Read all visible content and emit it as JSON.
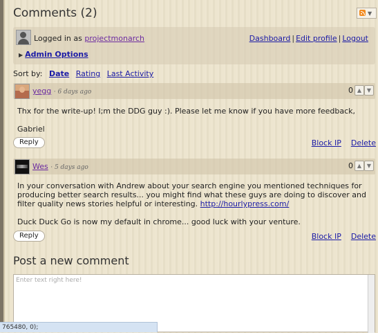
{
  "header": {
    "title": "Comments (2)",
    "rss_icon": "rss-feed-icon"
  },
  "user_box": {
    "logged_in_label": "Logged in as",
    "username": "projectmonarch",
    "links": {
      "dashboard": "Dashboard",
      "edit_profile": "Edit profile",
      "logout": "Logout",
      "separator": "|"
    },
    "admin_options": "Admin Options"
  },
  "sort": {
    "label": "Sort by:",
    "options": [
      "Date",
      "Rating",
      "Last Activity"
    ]
  },
  "comments": [
    {
      "author": "yegg",
      "time": "· 6 days ago",
      "score": "0",
      "body": [
        "Thx for the write-up! I;m the DDG guy :). Please let me know if you have more feedback,",
        "Gabriel"
      ],
      "reply": "Reply",
      "block_ip": "Block IP",
      "delete": "Delete"
    },
    {
      "author": "Wes",
      "time": "· 5 days ago",
      "score": "0",
      "body_p1": "In your conversation with Andrew about your search engine you mentioned techniques for producing better search results... you might find what these guys are doing to discover and filter quality news stories helpful or interesting.",
      "link": "http://hourlypress.com/",
      "body_p2": "Duck Duck Go is now my default in chrome... good luck with your venture.",
      "reply": "Reply",
      "block_ip": "Block IP",
      "delete": "Delete"
    }
  ],
  "post": {
    "heading": "Post a new comment",
    "placeholder": "Enter text right here!"
  },
  "status_bar": {
    "text": "765480, 0);"
  }
}
